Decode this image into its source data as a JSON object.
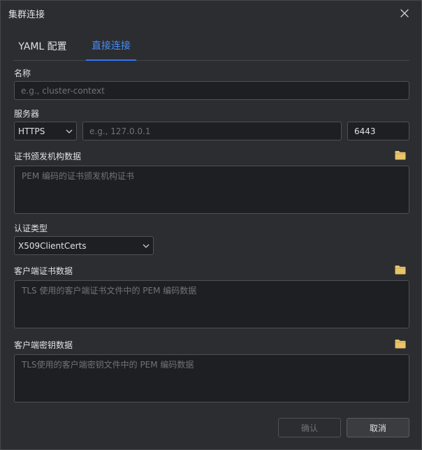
{
  "dialog": {
    "title": "集群连接",
    "close_icon": "close-icon"
  },
  "tabs": [
    {
      "label": "YAML 配置",
      "active": false
    },
    {
      "label": "直接连接",
      "active": true
    }
  ],
  "form": {
    "name": {
      "label": "名称",
      "value": "",
      "placeholder": "e.g., cluster-context"
    },
    "server": {
      "label": "服务器",
      "protocol": "HTTPS",
      "host": {
        "value": "",
        "placeholder": "e.g., 127.0.0.1"
      },
      "port": {
        "value": "6443"
      }
    },
    "ca_data": {
      "label": "证书颁发机构数据",
      "placeholder": "PEM 编码的证书颁发机构证书",
      "icon": "folder-icon"
    },
    "auth_type": {
      "label": "认证类型",
      "value": "X509ClientCerts"
    },
    "client_cert": {
      "label": "客户端证书数据",
      "placeholder": "TLS 使用的客户端证书文件中的 PEM 编码数据",
      "icon": "folder-icon"
    },
    "client_key": {
      "label": "客户端密钥数据",
      "placeholder": "TLS使用的客户端密钥文件中的 PEM 编码数据",
      "icon": "folder-icon"
    }
  },
  "footer": {
    "confirm_label": "确认",
    "cancel_label": "取消"
  },
  "colors": {
    "accent": "#3574f0",
    "folder": "#e8c46a",
    "background": "#2b2d30",
    "input_bg": "#1e1f22"
  }
}
